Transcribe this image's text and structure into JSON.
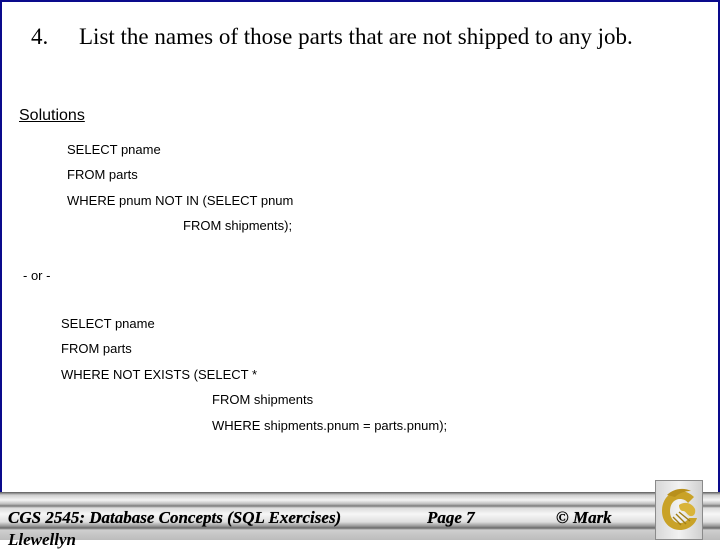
{
  "question": {
    "number": "4.",
    "text": "List the names of those parts that are not shipped to any job."
  },
  "solutions": {
    "label": "Solutions",
    "query1": [
      "SELECT pname",
      "FROM parts",
      "WHERE pnum NOT IN (SELECT pnum",
      "FROM shipments);"
    ],
    "separator": "- or -",
    "query2": [
      "SELECT pname",
      "FROM parts",
      "WHERE NOT EXISTS (SELECT *",
      "FROM shipments",
      "WHERE shipments.pnum = parts.pnum);"
    ]
  },
  "footer": {
    "course": "CGS 2545: Database Concepts  (SQL Exercises)",
    "page": "Page 7",
    "copyright": "© Mark",
    "overflow": "Llewellyn",
    "logo_icon": "pegasus-logo-icon",
    "logo_color": "#c9a227"
  }
}
